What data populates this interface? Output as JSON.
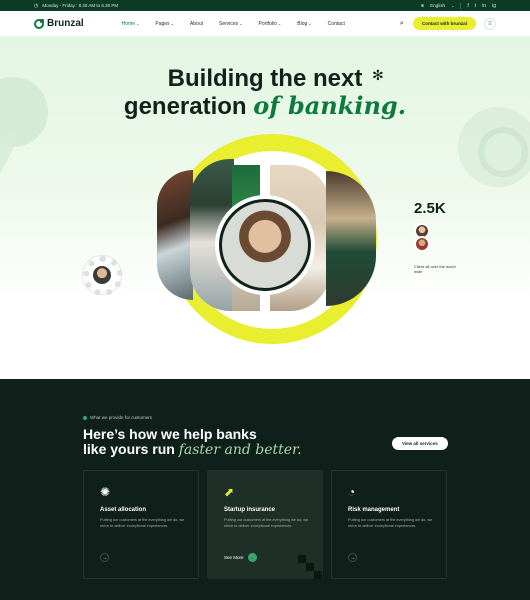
{
  "topbar": {
    "hours": "Monday - Friday : 8.30 AM to 6.30 PM",
    "language": "English",
    "social": [
      "f",
      "t",
      "in",
      "ig"
    ]
  },
  "nav": {
    "brand": "Brunzal",
    "items": [
      {
        "label": "Home",
        "dropdown": true,
        "active": true
      },
      {
        "label": "Pages",
        "dropdown": true
      },
      {
        "label": "About",
        "dropdown": false
      },
      {
        "label": "Services",
        "dropdown": true
      },
      {
        "label": "Portfolio",
        "dropdown": true
      },
      {
        "label": "Blog",
        "dropdown": true
      },
      {
        "label": "Contact",
        "dropdown": false
      }
    ],
    "cta": "Contact with brunzal",
    "icons": [
      "search-icon",
      "grid-menu-icon"
    ]
  },
  "hero": {
    "title_line1": "Building the next",
    "title_line2_plain": "generation ",
    "title_line2_accent": "of banking."
  },
  "stats": {
    "count": "2.5K",
    "caption": "Client all over the world wide"
  },
  "services": {
    "eyebrow": "What we provide for customers",
    "title_line1": "Here’s how we help banks",
    "title_line2_plain": "like yours run ",
    "title_line2_accent": "faster and better.",
    "view_all": "View all services",
    "cards": [
      {
        "title": "Asset allocation",
        "desc": "Putting our customers at the everything we do, we strive to deliver exceptional experiences.",
        "icon": "gear-icon"
      },
      {
        "title": "Startup insurance",
        "desc": "Putting our customers at the everything we do, we strive to deliver exceptional experiences.",
        "icon": "arrow-up-right-icon",
        "link": "See More"
      },
      {
        "title": "Risk management",
        "desc": "Putting our customers at the everything we do, we strive to deliver exceptional experiences.",
        "icon": "shield-icon"
      }
    ]
  },
  "colors": {
    "brand_green": "#0e7a3f",
    "accent_yellow": "#e9ee2f",
    "dark_bg": "#0f201a"
  }
}
